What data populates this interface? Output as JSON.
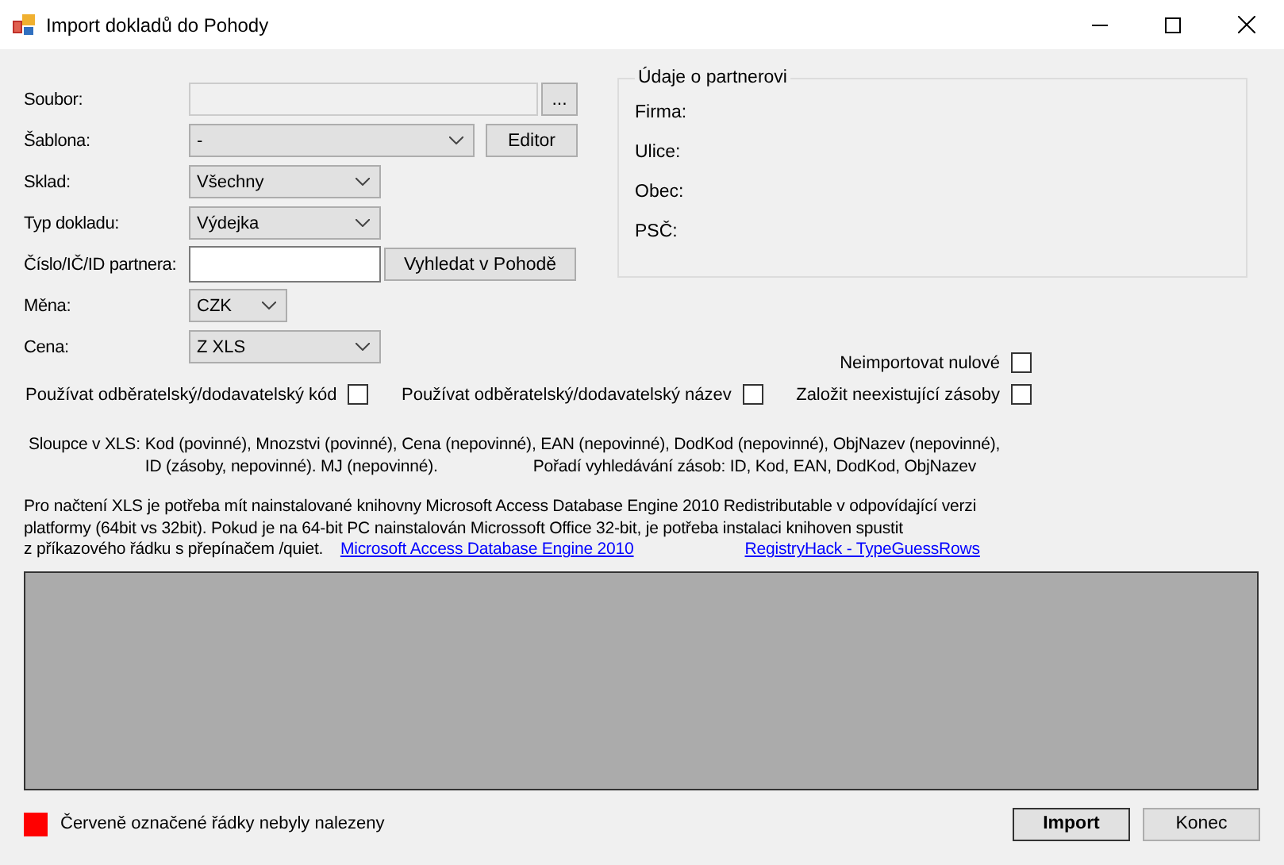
{
  "window": {
    "title": "Import dokladů do Pohody"
  },
  "form": [
    {
      "kind": "file",
      "label": "Soubor:",
      "button": "..."
    },
    {
      "kind": "combo-button",
      "label": "Šablona:",
      "value": "-",
      "button": "Editor"
    },
    {
      "kind": "combo",
      "label": "Sklad:",
      "value": "Všechny"
    },
    {
      "kind": "combo",
      "label": "Typ dokladu:",
      "value": "Výdejka"
    },
    {
      "kind": "text-button",
      "label": "Číslo/IČ/ID partnera:",
      "button": "Vyhledat v Pohodě"
    },
    {
      "kind": "combo-small",
      "label": "Měna:",
      "value": "CZK"
    },
    {
      "kind": "combo",
      "label": "Cena:",
      "value": "Z XLS"
    }
  ],
  "partner": {
    "title": "Údaje o partnerovi",
    "fields": [
      "Firma:",
      "Ulice:",
      "Obec:",
      "PSČ:"
    ]
  },
  "option_rows": [
    [
      {
        "label": "Neimportovat nulové",
        "checked": false
      }
    ],
    [
      {
        "label": "Používat odběratelský/dodavatelský kód",
        "checked": false
      },
      {
        "label": "Používat odběratelský/dodavatelský název",
        "checked": false
      },
      {
        "label": "Založit neexistující zásoby",
        "checked": false
      }
    ]
  ],
  "columns_info": {
    "label": "Sloupce v XLS:",
    "line1": "Kod (povinné), Mnozstvi (povinné), Cena (nepovinné), EAN (nepovinné), DodKod (nepovinné), ObjNazev (nepovinné),",
    "line2": "ID (zásoby, nepovinné). MJ (nepovinné).",
    "search_order": "Pořadí vyhledávání zásob: ID, Kod, EAN, DodKod, ObjNazev"
  },
  "note": {
    "lines": [
      "Pro načtení XLS je potřeba mít nainstalované knihovny Microsoft Access Database Engine 2010 Redistributable v odpovídající verzi",
      "platformy (64bit vs 32bit). Pokud je na 64-bit PC nainstalován Microssoft Office 32-bit, je potřeba instalaci knihoven spustit",
      "z příkazového řádku s přepínačem /quiet."
    ],
    "links": [
      "Microsoft Access Database Engine 2010",
      "RegistryHack - TypeGuessRows"
    ]
  },
  "legend": {
    "color": "#ff0000",
    "text": "Červeně označené řádky nebyly nalezeny"
  },
  "buttons": [
    {
      "label": "Import",
      "default": true
    },
    {
      "label": "Konec",
      "default": false
    }
  ]
}
